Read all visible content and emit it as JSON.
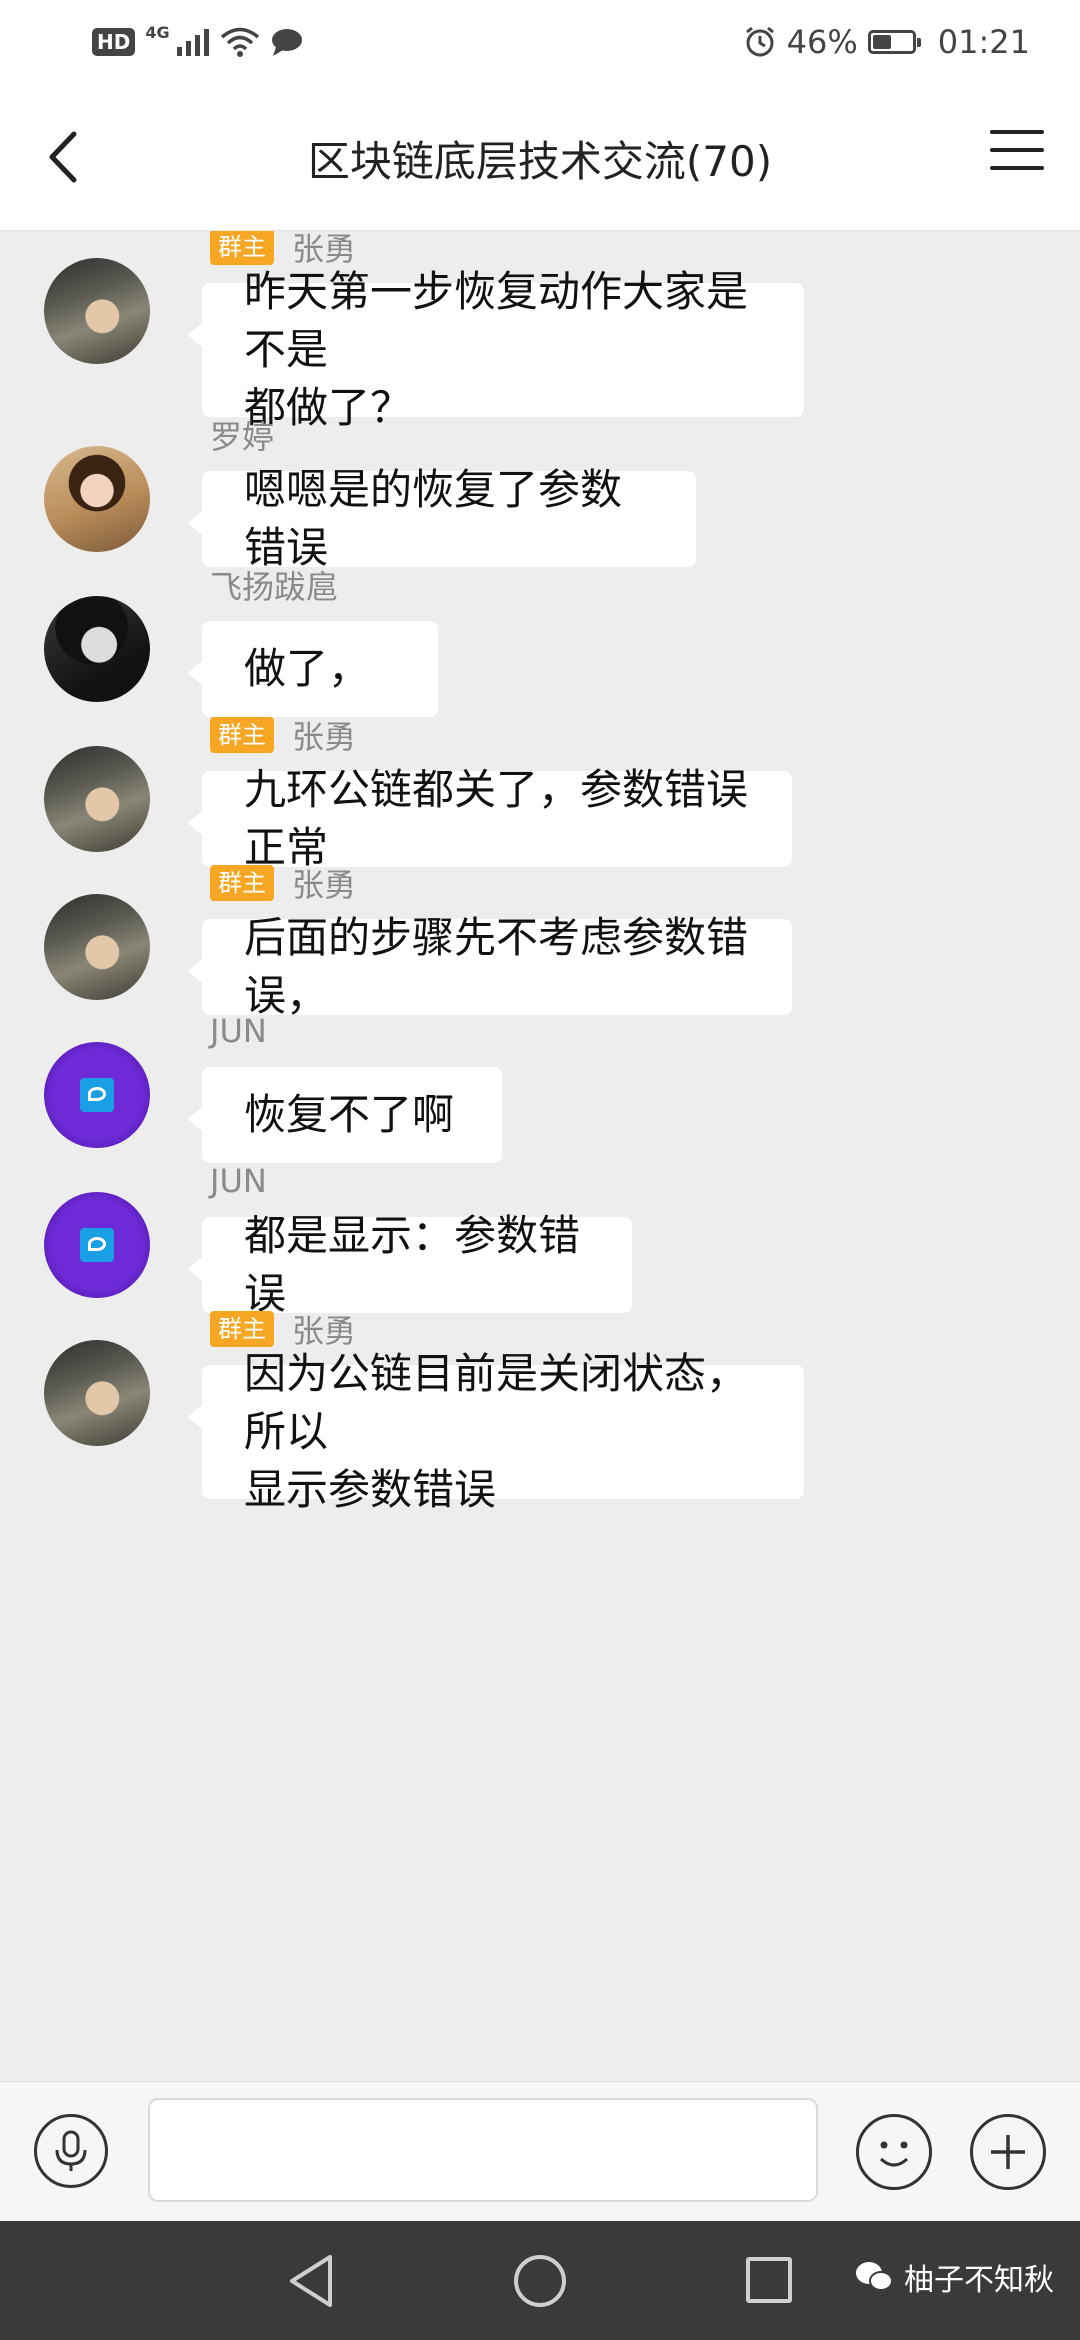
{
  "status_bar": {
    "hd": "HD",
    "network": "4G",
    "battery_text": "46%",
    "battery_level": 0.46,
    "time": "01:21"
  },
  "header": {
    "title": "区块链底层技术交流(70)"
  },
  "messages": [
    {
      "sender": "张勇",
      "badge": "群主",
      "lines": [
        "昨天第一步恢复动作大家是不是",
        "都做了？"
      ]
    },
    {
      "sender": "罗婷",
      "badge": "",
      "lines": [
        "嗯嗯是的恢复了参数错误"
      ]
    },
    {
      "sender": "飞扬跋扈",
      "badge": "",
      "lines": [
        "做了，"
      ]
    },
    {
      "sender": "张勇",
      "badge": "群主",
      "lines": [
        "九环公链都关了，参数错误正常"
      ]
    },
    {
      "sender": "张勇",
      "badge": "群主",
      "lines": [
        "后面的步骤先不考虑参数错误，"
      ]
    },
    {
      "sender": "JUN",
      "badge": "",
      "lines": [
        "恢复不了啊"
      ]
    },
    {
      "sender": "JUN",
      "badge": "",
      "lines": [
        "都是显示：参数错误"
      ]
    },
    {
      "sender": "张勇",
      "badge": "群主",
      "lines": [
        "因为公链目前是关闭状态，所以",
        "显示参数错误"
      ]
    }
  ],
  "input_bar": {
    "text_value": ""
  },
  "watermark": "柚子不知秋"
}
